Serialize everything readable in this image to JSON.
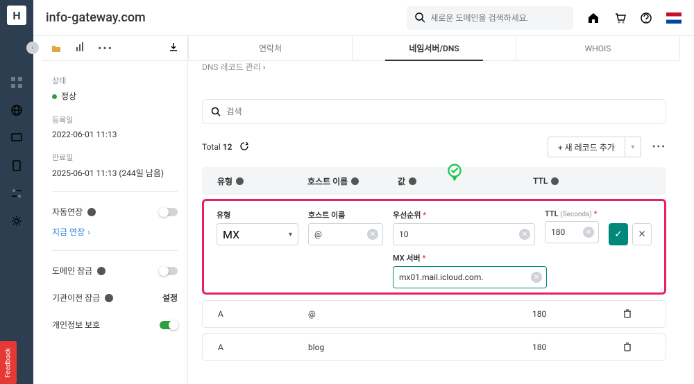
{
  "brand": {
    "letter": "H"
  },
  "topbar": {
    "title": "info-gateway.com",
    "search_placeholder": "새로운 도메인을 검색하세요."
  },
  "tabs": [
    "연락처",
    "네임서버/DNS",
    "WHOIS"
  ],
  "section_title": "DNS 레코드 관리",
  "side": {
    "status_label": "상태",
    "status_value": "정상",
    "reg_label": "등록일",
    "reg_value": "2022-06-01 11:13",
    "exp_label": "만료일",
    "exp_value": "2025-06-01 11:13 (244일 남음)",
    "auto_renew": "자동연장",
    "renew_now": "지금 연장",
    "domain_lock": "도메인 잠금",
    "transfer_lock": "기관이전 잠금",
    "transfer_settings": "설정",
    "privacy": "개인정보 보호"
  },
  "list": {
    "search_placeholder": "검색",
    "total_label": "Total",
    "total_count": "12",
    "add_button": "+ 새 레코드 추가"
  },
  "columns": {
    "type": "유형",
    "host": "호스트 이름",
    "value": "값",
    "ttl": "TTL"
  },
  "editor": {
    "type_label": "유형",
    "host_label": "호스트 이름",
    "priority_label": "우선순위",
    "ttl_label": "TTL",
    "ttl_hint": "(Seconds)",
    "mx_label": "MX 서버",
    "type_value": "MX",
    "host_value": "@",
    "priority_value": "10",
    "ttl_value": "180",
    "mx_value": "mx01.mail.icloud.com."
  },
  "rows": [
    {
      "type": "A",
      "host": "@",
      "ttl": "180"
    },
    {
      "type": "A",
      "host": "blog",
      "ttl": "180"
    }
  ],
  "feedback_label": "Feedback"
}
